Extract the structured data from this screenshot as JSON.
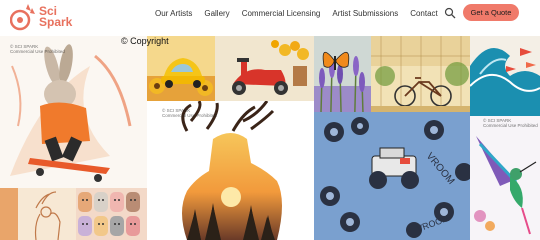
{
  "brand": {
    "line1": "Sci",
    "line2": "Spark",
    "accent": "#e8715e"
  },
  "nav": {
    "items": [
      {
        "label": "Our Artists"
      },
      {
        "label": "Gallery"
      },
      {
        "label": "Commercial Licensing"
      },
      {
        "label": "Artist Submissions"
      },
      {
        "label": "Contact"
      }
    ],
    "search_icon": "search-icon",
    "cta_label": "Get a Quote",
    "cta_color": "#f07a6a"
  },
  "gallery": {
    "copyright": "© Copyright",
    "watermark": "© SCI SPARK",
    "watermark_sub": "Commercial Use Prohibited",
    "tiles": [
      {
        "subject": "rabbit-skateboard"
      },
      {
        "subject": "yellow-beetle-car"
      },
      {
        "subject": "red-scooter-sunflowers"
      },
      {
        "subject": "butterfly-lavender"
      },
      {
        "subject": "bicycle-greenhouse"
      },
      {
        "subject": "ocean-wave-fish"
      },
      {
        "subject": "deer-forest-sunset"
      },
      {
        "subject": "monster-truck-pattern"
      },
      {
        "subject": "hummingbird-flowers"
      },
      {
        "subject": "cats-pattern"
      },
      {
        "subject": "deer-line-art"
      }
    ]
  }
}
